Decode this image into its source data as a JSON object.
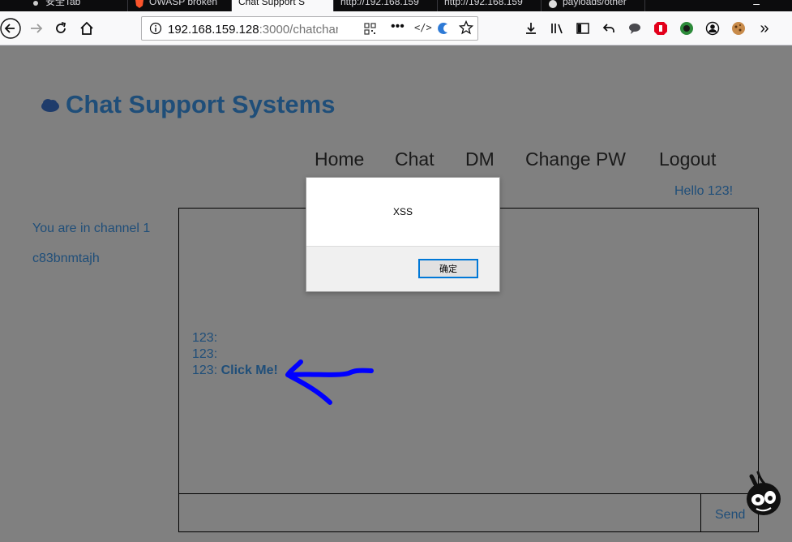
{
  "browser": {
    "tabs": [
      {
        "label": "安全Tab",
        "active": false
      },
      {
        "label": "OWASP broken",
        "active": false
      },
      {
        "label": "Chat Support S",
        "active": true
      },
      {
        "label": "http://192.168.159",
        "active": false
      },
      {
        "label": "http://192.168.159",
        "active": false
      },
      {
        "label": "payloads/other",
        "active": false
      }
    ],
    "url_host": "192.168.159.128",
    "url_rest": ":3000/chatchann"
  },
  "page": {
    "title": "Chat Support Systems",
    "nav": [
      "Home",
      "Chat",
      "DM",
      "Change PW",
      "Logout"
    ],
    "greeting": "Hello 123!",
    "channel_text": "You are in channel 1",
    "channel_id": "c83bnmtajh",
    "messages": [
      {
        "user": "123:",
        "text": ""
      },
      {
        "user": "123:",
        "text": ""
      },
      {
        "user": "123:",
        "text": "Click Me!"
      }
    ],
    "message_input_value": "",
    "send_label": "Send"
  },
  "dialog": {
    "message": "XSS",
    "ok_label": "确定"
  },
  "colors": {
    "accent": "#1f4e79",
    "page_bg": "#808080",
    "annotation": "#0000ff"
  }
}
